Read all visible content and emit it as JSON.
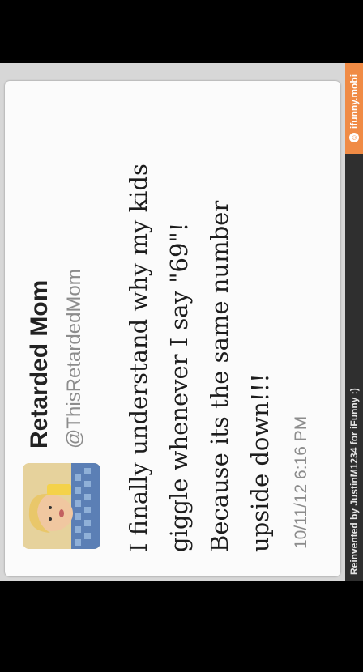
{
  "tweet": {
    "display_name": "Retarded Mom",
    "handle": "@ThisRetardedMom",
    "lines": [
      "I finally understand why my kids",
      "giggle whenever I say \"69\"!",
      "Because its the same number",
      "upside down!!!"
    ],
    "timestamp": "10/11/12 6:16 PM"
  },
  "footer": {
    "credit": "Reinvented by JustinM1234 for iFunny :)",
    "site": "ifunny.mobi"
  },
  "colors": {
    "badge": "#f08b45",
    "bar": "#2f2f2f",
    "card": "#fbfbfb"
  }
}
